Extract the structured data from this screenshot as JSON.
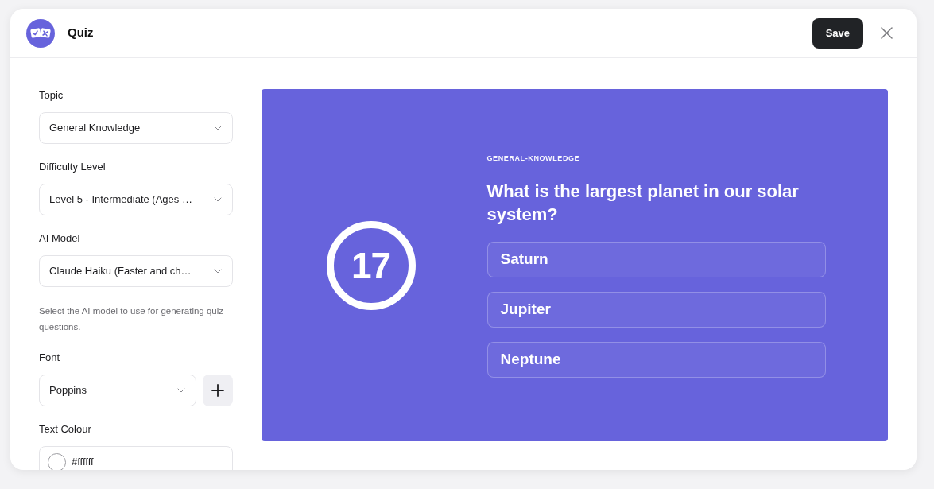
{
  "header": {
    "title": "Quiz",
    "save_button": "Save"
  },
  "settings": {
    "fields": [
      {
        "kind": "select",
        "label": "Topic",
        "value": "General Knowledge"
      },
      {
        "kind": "select",
        "label": "Difficulty Level",
        "value": "Level 5 - Intermediate (Ages …"
      },
      {
        "kind": "select",
        "label": "AI Model",
        "value": "Claude Haiku (Faster and ch…",
        "help": "Select the AI model to use for generating quiz questions."
      },
      {
        "kind": "select_add",
        "label": "Font",
        "value": "Poppins"
      },
      {
        "kind": "color",
        "label": "Text Colour",
        "value": "#ffffff"
      }
    ]
  },
  "preview": {
    "counter": "17",
    "category": "GENERAL-KNOWLEDGE",
    "question": "What is the largest planet in our solar system?",
    "options": [
      "Saturn",
      "Jupiter",
      "Neptune"
    ]
  }
}
